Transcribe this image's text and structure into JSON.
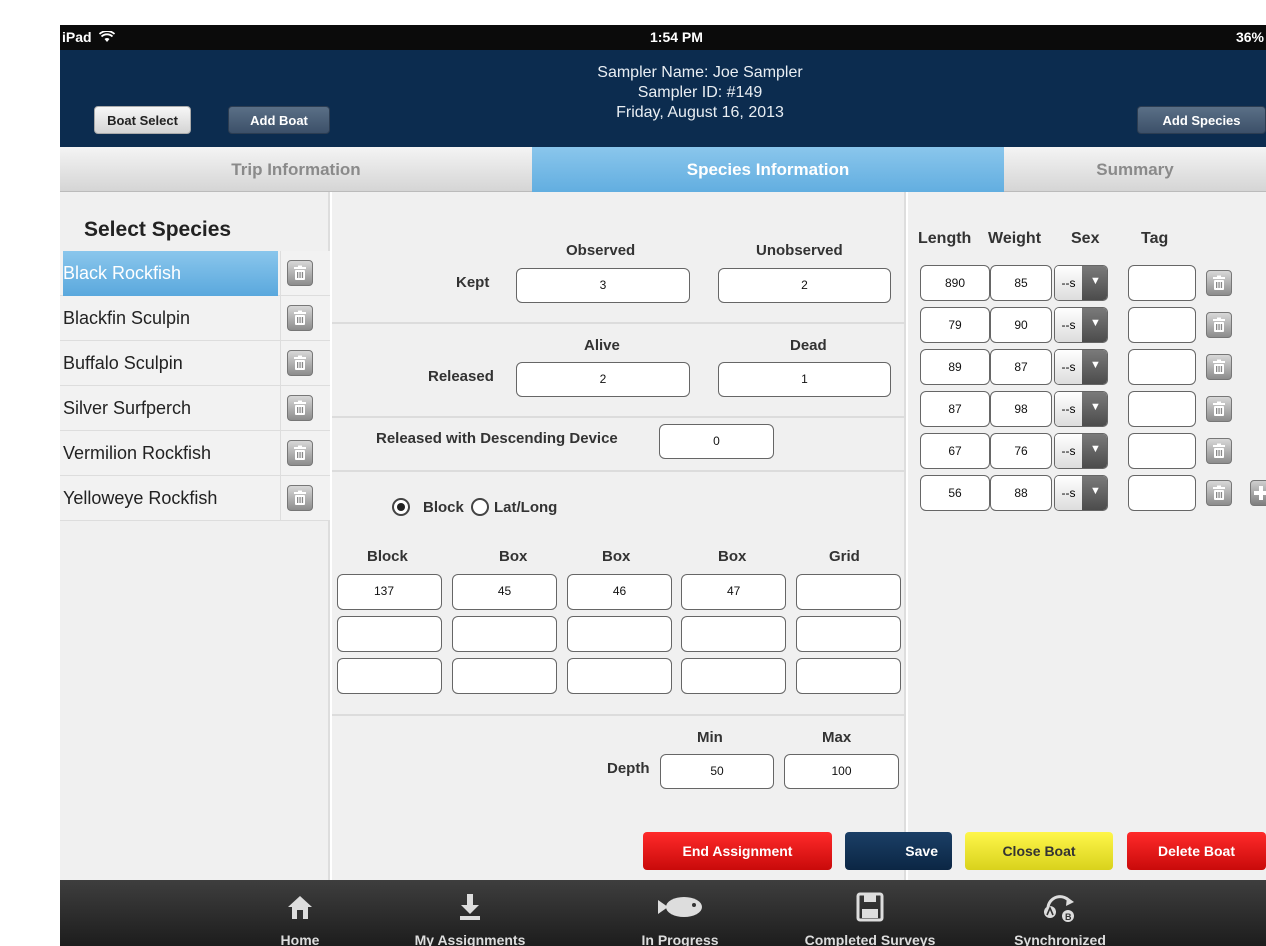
{
  "status_bar": {
    "device": "iPad",
    "time": "1:54 PM",
    "battery": "36%"
  },
  "header": {
    "sampler_name": "Sampler Name: Joe Sampler",
    "sampler_id": "Sampler ID: #149",
    "date": "Friday, August 16, 2013",
    "boat_select_label": "Boat Select",
    "add_boat_label": "Add Boat",
    "add_species_label": "Add Species"
  },
  "tabs": [
    {
      "label": "Trip Information",
      "active": false
    },
    {
      "label": "Species Information",
      "active": true
    },
    {
      "label": "Summary",
      "active": false
    }
  ],
  "species_panel": {
    "title": "Select Species",
    "items": [
      {
        "name": "Black Rockfish",
        "selected": true
      },
      {
        "name": "Blackfin Sculpin",
        "selected": false
      },
      {
        "name": "Buffalo Sculpin",
        "selected": false
      },
      {
        "name": "Silver Surfperch",
        "selected": false
      },
      {
        "name": "Vermilion Rockfish",
        "selected": false
      },
      {
        "name": "Yelloweye Rockfish",
        "selected": false
      }
    ]
  },
  "kept": {
    "label": "Kept",
    "col1_header": "Observed",
    "col2_header": "Unobserved",
    "observed": "3",
    "unobserved": "2"
  },
  "released": {
    "label": "Released",
    "col1_header": "Alive",
    "col2_header": "Dead",
    "alive": "2",
    "dead": "1"
  },
  "descending": {
    "label": "Released with Descending Device",
    "value": "0"
  },
  "location": {
    "mode_block_label": "Block",
    "mode_latlong_label": "Lat/Long",
    "selected_mode": "Block",
    "headers": [
      "Block",
      "Box",
      "Box",
      "Box",
      "Grid"
    ],
    "rows": [
      [
        "137",
        "45",
        "46",
        "47",
        ""
      ],
      [
        "",
        "",
        "",
        "",
        ""
      ],
      [
        "",
        "",
        "",
        "",
        ""
      ]
    ]
  },
  "depth": {
    "label": "Depth",
    "min_header": "Min",
    "max_header": "Max",
    "min": "50",
    "max": "100"
  },
  "measurements": {
    "headers": {
      "length": "Length",
      "weight": "Weight",
      "sex": "Sex",
      "tag": "Tag"
    },
    "rows": [
      {
        "length": "890",
        "weight": "85",
        "sex": "--s",
        "tag": ""
      },
      {
        "length": "79",
        "weight": "90",
        "sex": "--s",
        "tag": ""
      },
      {
        "length": "89",
        "weight": "87",
        "sex": "--s",
        "tag": ""
      },
      {
        "length": "87",
        "weight": "98",
        "sex": "--s",
        "tag": ""
      },
      {
        "length": "67",
        "weight": "76",
        "sex": "--s",
        "tag": ""
      },
      {
        "length": "56",
        "weight": "88",
        "sex": "--s",
        "tag": ""
      }
    ]
  },
  "actions": {
    "end_assignment": "End Assignment",
    "save": "Save",
    "close_boat": "Close Boat",
    "delete_boat": "Delete Boat"
  },
  "colors": {
    "header_bg": "#0c2c4f",
    "tab_active": "#6fb6e4",
    "red": "#d81d1d",
    "yellow": "#ecec3a",
    "save": "#0f2f52"
  },
  "bottom_nav": [
    {
      "label": "Home",
      "icon": "home-icon"
    },
    {
      "label": "My Assignments",
      "icon": "download-icon"
    },
    {
      "label": "In Progress",
      "icon": "fish-icon"
    },
    {
      "label": "Completed Surveys",
      "icon": "floppy-disk-icon"
    },
    {
      "label": "Synchronized",
      "icon": "sync-ab-icon"
    }
  ]
}
